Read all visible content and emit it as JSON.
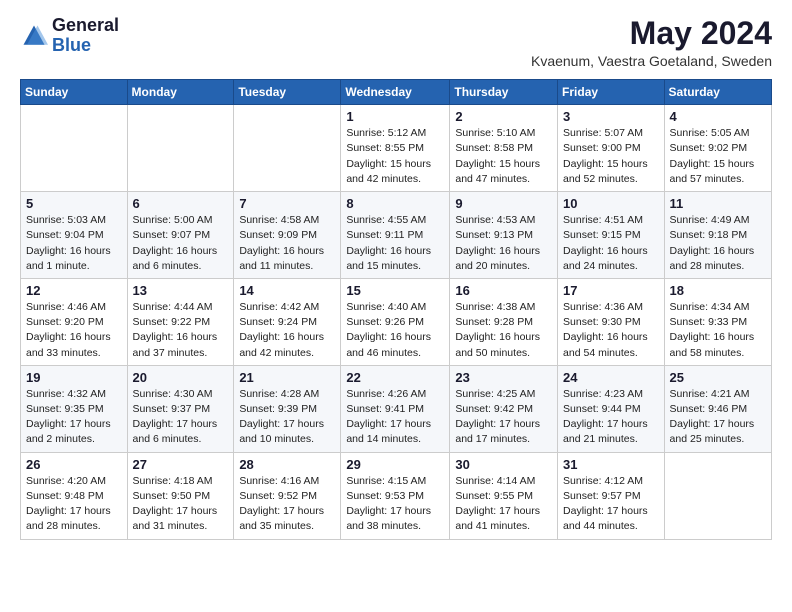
{
  "logo": {
    "general": "General",
    "blue": "Blue"
  },
  "title": "May 2024",
  "location": "Kvaenum, Vaestra Goetaland, Sweden",
  "days_header": [
    "Sunday",
    "Monday",
    "Tuesday",
    "Wednesday",
    "Thursday",
    "Friday",
    "Saturday"
  ],
  "weeks": [
    [
      {
        "day": "",
        "info": ""
      },
      {
        "day": "",
        "info": ""
      },
      {
        "day": "",
        "info": ""
      },
      {
        "day": "1",
        "info": "Sunrise: 5:12 AM\nSunset: 8:55 PM\nDaylight: 15 hours\nand 42 minutes."
      },
      {
        "day": "2",
        "info": "Sunrise: 5:10 AM\nSunset: 8:58 PM\nDaylight: 15 hours\nand 47 minutes."
      },
      {
        "day": "3",
        "info": "Sunrise: 5:07 AM\nSunset: 9:00 PM\nDaylight: 15 hours\nand 52 minutes."
      },
      {
        "day": "4",
        "info": "Sunrise: 5:05 AM\nSunset: 9:02 PM\nDaylight: 15 hours\nand 57 minutes."
      }
    ],
    [
      {
        "day": "5",
        "info": "Sunrise: 5:03 AM\nSunset: 9:04 PM\nDaylight: 16 hours\nand 1 minute."
      },
      {
        "day": "6",
        "info": "Sunrise: 5:00 AM\nSunset: 9:07 PM\nDaylight: 16 hours\nand 6 minutes."
      },
      {
        "day": "7",
        "info": "Sunrise: 4:58 AM\nSunset: 9:09 PM\nDaylight: 16 hours\nand 11 minutes."
      },
      {
        "day": "8",
        "info": "Sunrise: 4:55 AM\nSunset: 9:11 PM\nDaylight: 16 hours\nand 15 minutes."
      },
      {
        "day": "9",
        "info": "Sunrise: 4:53 AM\nSunset: 9:13 PM\nDaylight: 16 hours\nand 20 minutes."
      },
      {
        "day": "10",
        "info": "Sunrise: 4:51 AM\nSunset: 9:15 PM\nDaylight: 16 hours\nand 24 minutes."
      },
      {
        "day": "11",
        "info": "Sunrise: 4:49 AM\nSunset: 9:18 PM\nDaylight: 16 hours\nand 28 minutes."
      }
    ],
    [
      {
        "day": "12",
        "info": "Sunrise: 4:46 AM\nSunset: 9:20 PM\nDaylight: 16 hours\nand 33 minutes."
      },
      {
        "day": "13",
        "info": "Sunrise: 4:44 AM\nSunset: 9:22 PM\nDaylight: 16 hours\nand 37 minutes."
      },
      {
        "day": "14",
        "info": "Sunrise: 4:42 AM\nSunset: 9:24 PM\nDaylight: 16 hours\nand 42 minutes."
      },
      {
        "day": "15",
        "info": "Sunrise: 4:40 AM\nSunset: 9:26 PM\nDaylight: 16 hours\nand 46 minutes."
      },
      {
        "day": "16",
        "info": "Sunrise: 4:38 AM\nSunset: 9:28 PM\nDaylight: 16 hours\nand 50 minutes."
      },
      {
        "day": "17",
        "info": "Sunrise: 4:36 AM\nSunset: 9:30 PM\nDaylight: 16 hours\nand 54 minutes."
      },
      {
        "day": "18",
        "info": "Sunrise: 4:34 AM\nSunset: 9:33 PM\nDaylight: 16 hours\nand 58 minutes."
      }
    ],
    [
      {
        "day": "19",
        "info": "Sunrise: 4:32 AM\nSunset: 9:35 PM\nDaylight: 17 hours\nand 2 minutes."
      },
      {
        "day": "20",
        "info": "Sunrise: 4:30 AM\nSunset: 9:37 PM\nDaylight: 17 hours\nand 6 minutes."
      },
      {
        "day": "21",
        "info": "Sunrise: 4:28 AM\nSunset: 9:39 PM\nDaylight: 17 hours\nand 10 minutes."
      },
      {
        "day": "22",
        "info": "Sunrise: 4:26 AM\nSunset: 9:41 PM\nDaylight: 17 hours\nand 14 minutes."
      },
      {
        "day": "23",
        "info": "Sunrise: 4:25 AM\nSunset: 9:42 PM\nDaylight: 17 hours\nand 17 minutes."
      },
      {
        "day": "24",
        "info": "Sunrise: 4:23 AM\nSunset: 9:44 PM\nDaylight: 17 hours\nand 21 minutes."
      },
      {
        "day": "25",
        "info": "Sunrise: 4:21 AM\nSunset: 9:46 PM\nDaylight: 17 hours\nand 25 minutes."
      }
    ],
    [
      {
        "day": "26",
        "info": "Sunrise: 4:20 AM\nSunset: 9:48 PM\nDaylight: 17 hours\nand 28 minutes."
      },
      {
        "day": "27",
        "info": "Sunrise: 4:18 AM\nSunset: 9:50 PM\nDaylight: 17 hours\nand 31 minutes."
      },
      {
        "day": "28",
        "info": "Sunrise: 4:16 AM\nSunset: 9:52 PM\nDaylight: 17 hours\nand 35 minutes."
      },
      {
        "day": "29",
        "info": "Sunrise: 4:15 AM\nSunset: 9:53 PM\nDaylight: 17 hours\nand 38 minutes."
      },
      {
        "day": "30",
        "info": "Sunrise: 4:14 AM\nSunset: 9:55 PM\nDaylight: 17 hours\nand 41 minutes."
      },
      {
        "day": "31",
        "info": "Sunrise: 4:12 AM\nSunset: 9:57 PM\nDaylight: 17 hours\nand 44 minutes."
      },
      {
        "day": "",
        "info": ""
      }
    ]
  ]
}
